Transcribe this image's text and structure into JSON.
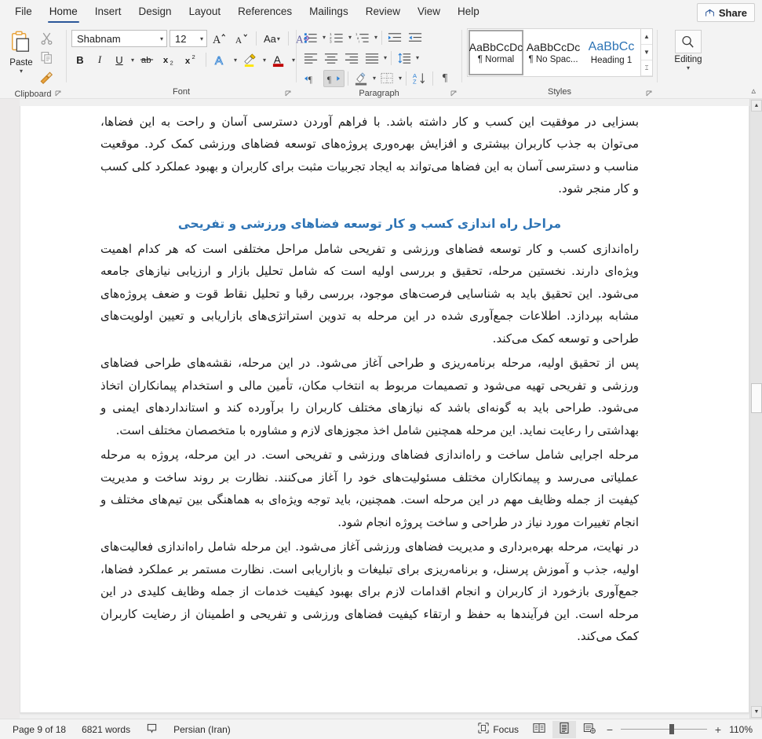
{
  "tabs": [
    {
      "label": "File",
      "active": false
    },
    {
      "label": "Home",
      "active": true
    },
    {
      "label": "Insert",
      "active": false
    },
    {
      "label": "Design",
      "active": false
    },
    {
      "label": "Layout",
      "active": false
    },
    {
      "label": "References",
      "active": false
    },
    {
      "label": "Mailings",
      "active": false
    },
    {
      "label": "Review",
      "active": false
    },
    {
      "label": "View",
      "active": false
    },
    {
      "label": "Help",
      "active": false
    }
  ],
  "share": {
    "label": "Share",
    "icon": "share-icon"
  },
  "ribbon": {
    "clipboard": {
      "group_label": "Clipboard",
      "paste_label": "Paste",
      "paste_icon": "paste-icon",
      "cut_icon": "scissors-icon",
      "copy_icon": "copy-icon",
      "format_painter_icon": "format-painter-icon"
    },
    "font": {
      "group_label": "Font",
      "font_name": "Shabnam",
      "font_size": "12",
      "grow_font_icon": "grow-font-icon",
      "shrink_font_icon": "shrink-font-icon",
      "change_case_icon": "change-case-icon",
      "clear_formatting_icon": "clear-formatting-icon",
      "bold": "B",
      "italic": "I",
      "underline": "U",
      "strikethrough_icon": "strikethrough-icon",
      "subscript_icon": "subscript-icon",
      "superscript_icon": "superscript-icon",
      "text_effects_icon": "text-effects-icon",
      "highlight_icon": "text-highlight-icon",
      "font_color_icon": "font-color-icon",
      "highlight_color": "#ffe600",
      "font_color": "#c00000"
    },
    "paragraph": {
      "group_label": "Paragraph",
      "bullets_icon": "bullets-icon",
      "numbering_icon": "numbering-icon",
      "multilevel_icon": "multilevel-list-icon",
      "decrease_indent_icon": "decrease-indent-icon",
      "increase_indent_icon": "increase-indent-icon",
      "align_left_icon": "align-left-icon",
      "align_center_icon": "align-center-icon",
      "align_right_icon": "align-right-icon",
      "justify_icon": "justify-icon",
      "line_spacing_icon": "line-spacing-icon",
      "ltr_icon": "left-to-right-icon",
      "rtl_icon": "right-to-left-icon",
      "shading_icon": "shading-icon",
      "borders_icon": "borders-icon",
      "sort_icon": "sort-icon",
      "show_marks_icon": "show-formatting-marks-icon"
    },
    "styles": {
      "group_label": "Styles",
      "items": [
        {
          "preview": "AaBbCcDc",
          "name": "¶ Normal",
          "selected": true
        },
        {
          "preview": "AaBbCcDc",
          "name": "¶ No Spac...",
          "selected": false
        },
        {
          "preview": "AaBbCc",
          "name": "Heading 1",
          "selected": false
        }
      ]
    },
    "editing": {
      "group_label": "",
      "label": "Editing",
      "icon": "magnifier-icon"
    },
    "collapse_icon": "collapse-ribbon-icon"
  },
  "document": {
    "language_dir": "rtl",
    "heading_color": "#2e74b5",
    "blocks": [
      {
        "type": "paragraph",
        "clipped_top": true,
        "text": "در نهایت، بهبود زیرساخت‌ها و امکانات حمل و نقل در اطراف فضاهای ورزشی و تفریحی نیز می‌تواند تأثیر بسزایی در موفقیت این کسب و کار داشته باشد. با فراهم آوردن دسترسی آسان و راحت به این فضاها، می‌توان به جذب کاربران بیشتری و افزایش بهره‌وری پروژه‌های توسعه فضاهای ورزشی کمک کرد. موقعیت مناسب و دسترسی آسان به این فضاها می‌تواند به ایجاد تجربیات مثبت برای کاربران و بهبود عملکرد کلی کسب و کار منجر شود."
      },
      {
        "type": "heading",
        "text": "مراحل راه اندازی کسب و کار توسعه فضاهای ورزشی و تفریحی"
      },
      {
        "type": "paragraph",
        "text": "راه‌اندازی کسب و کار توسعه فضاهای ورزشی و تفریحی شامل مراحل مختلفی است که هر کدام اهمیت ویژه‌ای دارند. نخستین مرحله، تحقیق و بررسی اولیه است که شامل تحلیل بازار و ارزیابی نیازهای جامعه می‌شود. این تحقیق باید به شناسایی فرصت‌های موجود، بررسی رقبا و تحلیل نقاط قوت و ضعف پروژه‌های مشابه بپردازد. اطلاعات جمع‌آوری شده در این مرحله به تدوین استراتژی‌های بازاریابی و تعیین اولویت‌های طراحی و توسعه کمک می‌کند."
      },
      {
        "type": "paragraph",
        "text": "پس از تحقیق اولیه، مرحله برنامه‌ریزی و طراحی آغاز می‌شود. در این مرحله، نقشه‌های طراحی فضاهای ورزشی و تفریحی تهیه می‌شود و تصمیمات مربوط به انتخاب مکان، تأمین مالی و استخدام پیمانکاران اتخاذ می‌شود. طراحی باید به گونه‌ای باشد که نیازهای مختلف کاربران را برآورده کند و استانداردهای ایمنی و بهداشتی را رعایت نماید. این مرحله همچنین شامل اخذ مجوزهای لازم و مشاوره با متخصصان مختلف است."
      },
      {
        "type": "paragraph",
        "text": "مرحله اجرایی شامل ساخت و راه‌اندازی فضاهای ورزشی و تفریحی است. در این مرحله، پروژه به مرحله عملیاتی می‌رسد و پیمانکاران مختلف مسئولیت‌های خود را آغاز می‌کنند. نظارت بر روند ساخت و مدیریت کیفیت از جمله وظایف مهم در این مرحله است. همچنین، باید توجه ویژه‌ای به هماهنگی بین تیم‌های مختلف و انجام تغییرات مورد نیاز در طراحی و ساخت پروژه انجام شود."
      },
      {
        "type": "paragraph",
        "text": "در نهایت، مرحله بهره‌برداری و مدیریت فضاهای ورزشی آغاز می‌شود. این مرحله شامل راه‌اندازی فعالیت‌های اولیه، جذب و آموزش پرسنل، و برنامه‌ریزی برای تبلیغات و بازاریابی است. نظارت مستمر بر عملکرد فضاها، جمع‌آوری بازخورد از کاربران و انجام اقدامات لازم برای بهبود کیفیت خدمات از جمله وظایف کلیدی در این مرحله است. این فرآیندها به حفظ و ارتقاء کیفیت فضاهای ورزشی و تفریحی و اطمینان از رضایت کاربران کمک می‌کند."
      }
    ]
  },
  "statusbar": {
    "page_info": "Page 9 of 18",
    "word_count": "6821 words",
    "proofing_icon": "proofing-errors-icon",
    "language": "Persian (Iran)",
    "focus_label": "Focus",
    "focus_icon": "focus-mode-icon",
    "read_mode_icon": "read-mode-icon",
    "print_layout_icon": "print-layout-icon",
    "web_layout_icon": "web-layout-icon",
    "zoom_out": "−",
    "zoom_in": "+",
    "zoom_level": "110%"
  }
}
